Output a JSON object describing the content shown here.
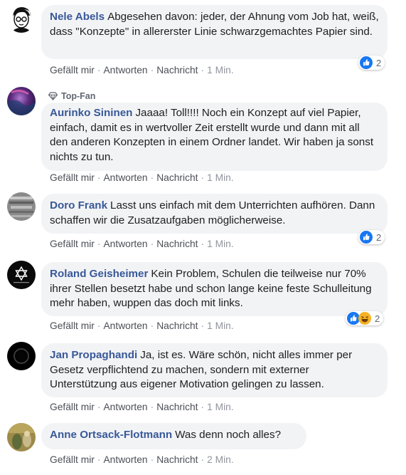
{
  "actions": {
    "like": "Gefällt mir",
    "reply": "Antworten",
    "message": "Nachricht",
    "separator": "·"
  },
  "badge": {
    "icon": "diamond-icon",
    "label": "Top-Fan"
  },
  "colors": {
    "name": "#385898",
    "bubble": "#f2f3f5",
    "like_blue": "#1877f2",
    "haha_yellow": "#f7b125"
  },
  "comments": [
    {
      "author": "Nele Abels",
      "text": "Abgesehen davon: jeder, der Ahnung vom Job hat, weiß, dass \"Konzepte\" in allererster Linie schwarzgemachtes Papier sind.",
      "time": "1 Min.",
      "reactions": [
        "like-icon"
      ],
      "reaction_count": "2"
    },
    {
      "badge": true,
      "author": "Aurinko Sininen",
      "text": "Jaaaa! Toll!!!! Noch ein Konzept auf viel Papier, einfach, damit es in wertvoller Zeit erstellt wurde und dann mit all den anderen Konzepten in einem Ordner landet. Wir haben ja sonst nichts zu tun.",
      "time": "1 Min."
    },
    {
      "author": "Doro Frank",
      "text": "Lasst uns einfach mit dem Unterrichten aufhören. Dann schaffen wir die Zusatzaufgaben möglicherweise.",
      "time": "1 Min.",
      "reactions": [
        "like-icon"
      ],
      "reaction_count": "2"
    },
    {
      "author": "Roland Geisheimer",
      "text": "Kein Problem, Schulen die teilweise nur 70% ihrer Stellen besetzt habe und schon lange keine feste Schulleitung mehr haben, wuppen das doch mit links.",
      "time": "1 Min.",
      "reactions": [
        "like-icon",
        "haha-icon"
      ],
      "reaction_count": "2"
    },
    {
      "author": "Jan Propaghandi",
      "text": "Ja, ist es. Wäre schön, nicht alles immer per Gesetz verpflichtend zu machen, sondern mit externer Unterstützung aus eigener Motivation gelingen zu lassen.",
      "time": "1 Min."
    },
    {
      "author": "Anne Ortsack-Flotmann",
      "text": "Was denn noch alles?",
      "time": "2 Min."
    }
  ]
}
